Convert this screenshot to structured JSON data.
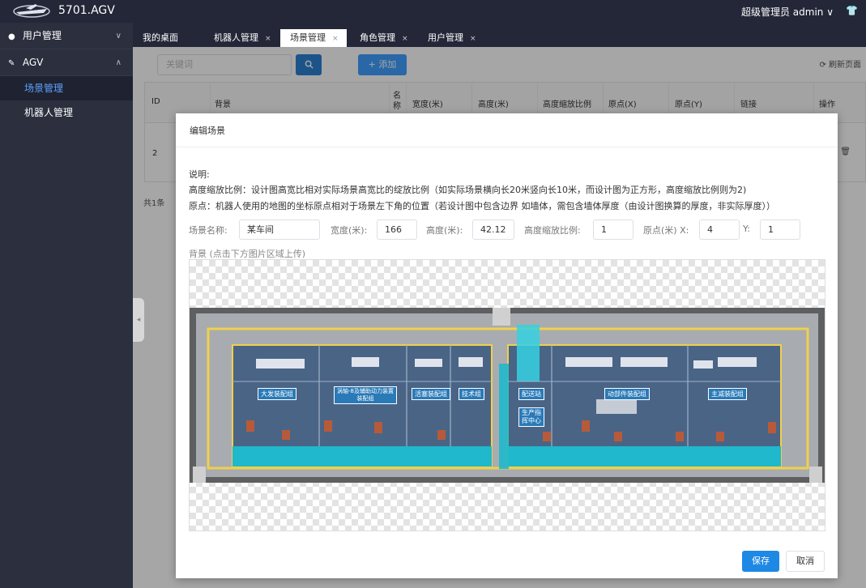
{
  "app": {
    "title": "5701.AGV",
    "user": "超级管理员 admin ∨",
    "shirt_icon": "tshirt-icon"
  },
  "sidebar": {
    "groups": [
      {
        "label": "用户管理",
        "icon": "user-circle-icon",
        "chevron": "∨"
      },
      {
        "label": "AGV",
        "icon": "wrench-icon",
        "chevron": "∧"
      }
    ],
    "items": [
      {
        "label": "场景管理"
      },
      {
        "label": "机器人管理"
      }
    ]
  },
  "tabs": [
    {
      "label": "我的桌面",
      "close": ""
    },
    {
      "label": "机器人管理",
      "close": "×"
    },
    {
      "label": "场景管理",
      "close": "×"
    },
    {
      "label": "角色管理",
      "close": "×"
    },
    {
      "label": "用户管理",
      "close": "×"
    }
  ],
  "toolbar": {
    "search_placeholder": "关键词",
    "add_label": "+ 添加",
    "refresh_label": "⟳ 刷新页面"
  },
  "table": {
    "headers": [
      "ID",
      "背景",
      "名称",
      "宽度(米)",
      "高度(米)",
      "高度缩放比例",
      "原点(X)",
      "原点(Y)",
      "链接",
      "操作"
    ],
    "rows": [
      {
        "id": "2"
      }
    ],
    "total": "共1条"
  },
  "dialog": {
    "title": "编辑场景",
    "note_title": "说明:",
    "note_1": "高度缩放比例：设计图高宽比相对实际场景高宽比的绽放比例（如实际场景横向长20米竖向长10米，而设计图为正方形，高度缩放比例则为2)",
    "note_2": "原点：机器人使用的地图的坐标原点相对于场景左下角的位置（若设计图中包含边界 如墙体，需包含墙体厚度（由设计图换算的厚度，非实际厚度））",
    "fields": {
      "name_label": "场景名称:",
      "name_value": "某车间",
      "width_label": "宽度(米):",
      "width_value": "166",
      "height_label": "高度(米):",
      "height_value": "42.12",
      "scale_label": "高度缩放比例:",
      "scale_value": "1",
      "origin_x_label": "原点(米) X:",
      "origin_x_value": "4",
      "origin_y_label": "Y:",
      "origin_y_value": "1"
    },
    "bg_label": "背景 (点击下方图片区域上传)",
    "zones": [
      {
        "label": "大发装配组"
      },
      {
        "label": "涡轴-8及辅助动力装置装配组"
      },
      {
        "label": "活塞装配组"
      },
      {
        "label": "技术组"
      },
      {
        "label": "配送站"
      },
      {
        "label": "生产指挥中心"
      },
      {
        "label": "动部件装配组"
      },
      {
        "label": "主减装配组"
      }
    ],
    "save_label": "保存",
    "cancel_label": "取消"
  }
}
